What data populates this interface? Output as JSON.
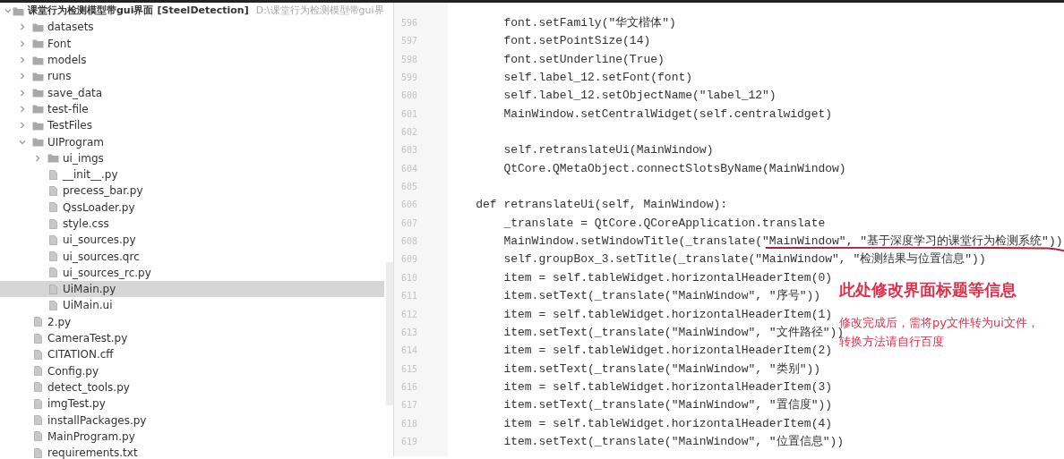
{
  "project": {
    "name": "课堂行为检测模型带gui界面",
    "module": "[SteelDetection]",
    "path": "D:\\课堂行为检测模型带gui界",
    "expanded": true
  },
  "tree": [
    {
      "label": "datasets",
      "kind": "folder",
      "expanded": false,
      "selected": false
    },
    {
      "label": "Font",
      "kind": "folder",
      "expanded": false,
      "selected": false
    },
    {
      "label": "models",
      "kind": "folder",
      "expanded": false,
      "selected": false
    },
    {
      "label": "runs",
      "kind": "folder",
      "expanded": false,
      "selected": false
    },
    {
      "label": "save_data",
      "kind": "folder",
      "expanded": false,
      "selected": false
    },
    {
      "label": "test-file",
      "kind": "folder",
      "expanded": false,
      "selected": false
    },
    {
      "label": "TestFiles",
      "kind": "folder",
      "expanded": false,
      "selected": false
    },
    {
      "label": "UIProgram",
      "kind": "folder",
      "expanded": true,
      "selected": false,
      "children": [
        {
          "label": "ui_imgs",
          "kind": "folder",
          "expanded": false,
          "selected": false
        },
        {
          "label": "__init__.py",
          "kind": "file",
          "selected": false
        },
        {
          "label": "precess_bar.py",
          "kind": "file",
          "selected": false
        },
        {
          "label": "QssLoader.py",
          "kind": "file",
          "selected": false
        },
        {
          "label": "style.css",
          "kind": "file",
          "selected": false
        },
        {
          "label": "ui_sources.py",
          "kind": "file",
          "selected": false
        },
        {
          "label": "ui_sources.qrc",
          "kind": "file",
          "selected": false
        },
        {
          "label": "ui_sources_rc.py",
          "kind": "file",
          "selected": false
        },
        {
          "label": "UiMain.py",
          "kind": "file",
          "selected": true
        },
        {
          "label": "UiMain.ui",
          "kind": "file",
          "selected": false
        }
      ]
    },
    {
      "label": "2.py",
      "kind": "file",
      "selected": false
    },
    {
      "label": "CameraTest.py",
      "kind": "file",
      "selected": false
    },
    {
      "label": "CITATION.cff",
      "kind": "file",
      "selected": false
    },
    {
      "label": "Config.py",
      "kind": "file",
      "selected": false
    },
    {
      "label": "detect_tools.py",
      "kind": "file",
      "selected": false
    },
    {
      "label": "imgTest.py",
      "kind": "file",
      "selected": false
    },
    {
      "label": "installPackages.py",
      "kind": "file",
      "selected": false
    },
    {
      "label": "MainProgram.py",
      "kind": "file",
      "selected": false
    },
    {
      "label": "requirements.txt",
      "kind": "file",
      "selected": false
    }
  ],
  "editor": {
    "lines": [
      {
        "number": "596",
        "code": "        font.setFamily(\"华文楷体\")",
        "marked": false
      },
      {
        "number": "597",
        "code": "        font.setPointSize(14)",
        "marked": false
      },
      {
        "number": "598",
        "code": "        font.setUnderline(True)",
        "marked": false
      },
      {
        "number": "599",
        "code": "        self.label_12.setFont(font)",
        "marked": false
      },
      {
        "number": "600",
        "code": "        self.label_12.setObjectName(\"label_12\")",
        "marked": false
      },
      {
        "number": "601",
        "code": "        MainWindow.setCentralWidget(self.centralwidget)",
        "marked": false
      },
      {
        "number": "602",
        "marked": false
      },
      {
        "number": "603",
        "code": "        self.retranslateUi(MainWindow)",
        "marked": false
      },
      {
        "number": "604",
        "code": "        QtCore.QMetaObject.connectSlotsByName(MainWindow)",
        "marked": false
      },
      {
        "number": "605",
        "marked": false
      },
      {
        "number": "606",
        "code": "    def retranslateUi(self, MainWindow):",
        "marked": false
      },
      {
        "number": "607",
        "code": "        _translate = QtCore.QCoreApplication.translate",
        "marked": false
      },
      {
        "number": "608",
        "code": "        MainWindow.setWindowTitle(_translate(\"MainWindow\", \"基于深度学习的课堂行为检测系统\"))",
        "marked": true
      },
      {
        "number": "609",
        "code": "        self.groupBox_3.setTitle(_translate(\"MainWindow\", \"检测结果与位置信息\"))",
        "marked": false
      },
      {
        "number": "610",
        "code": "        item = self.tableWidget.horizontalHeaderItem(0)",
        "marked": false
      },
      {
        "number": "611",
        "code": "        item.setText(_translate(\"MainWindow\", \"序号\"))",
        "marked": false
      },
      {
        "number": "612",
        "code": "        item = self.tableWidget.horizontalHeaderItem(1)",
        "marked": false
      },
      {
        "number": "613",
        "code": "        item.setText(_translate(\"MainWindow\", \"文件路径\"))",
        "marked": false
      },
      {
        "number": "614",
        "code": "        item = self.tableWidget.horizontalHeaderItem(2)",
        "marked": false
      },
      {
        "number": "615",
        "code": "        item.setText(_translate(\"MainWindow\", \"类别\"))",
        "marked": false
      },
      {
        "number": "616",
        "code": "        item = self.tableWidget.horizontalHeaderItem(3)",
        "marked": false
      },
      {
        "number": "617",
        "code": "        item.setText(_translate(\"MainWindow\", \"置信度\"))",
        "marked": false
      },
      {
        "number": "618",
        "code": "        item = self.tableWidget.horizontalHeaderItem(4)",
        "marked": false
      },
      {
        "number": "619",
        "code": "        item.setText(_translate(\"MainWindow\", \"位置信息\"))",
        "marked": false
      }
    ]
  },
  "annotations": [
    {
      "kind": "heading",
      "text": "此处修改界面标题等信息"
    },
    {
      "kind": "note",
      "text": "修改完成后，需将py文件转为ui文件，转换方法请自行百度"
    }
  ]
}
